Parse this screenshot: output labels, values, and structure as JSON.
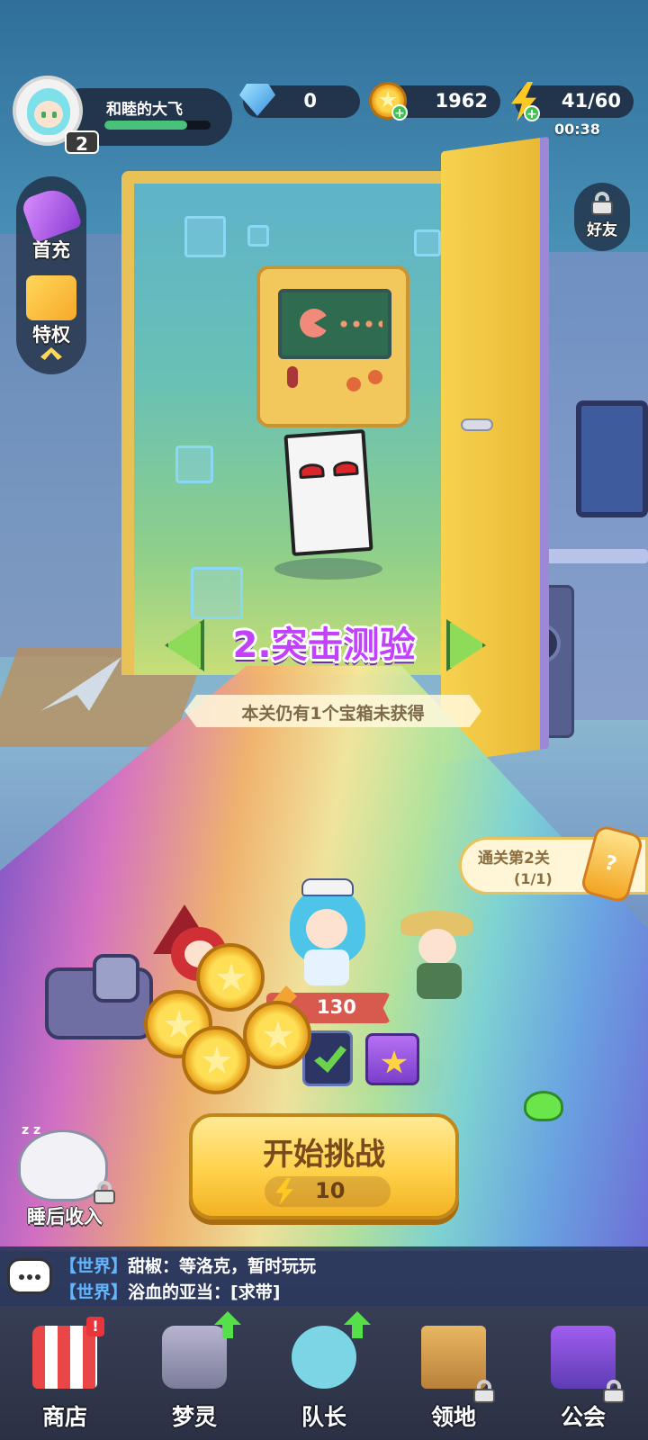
{
  "player": {
    "name": "和睦的大飞",
    "level": "2",
    "xp_progress": 0.78
  },
  "resources": {
    "diamonds": "0",
    "gold": "1962",
    "energy": "41/60",
    "energy_timer": "00:38"
  },
  "left_menu": {
    "first_charge": "首充",
    "privilege": "特权"
  },
  "friends_label": "好友",
  "stage": {
    "title": "2.突击测验",
    "subtitle": "本关仍有1个宝箱未获得"
  },
  "quest": {
    "title": "通关第2关",
    "progress": "(1/1)"
  },
  "team": {
    "power": "130"
  },
  "start_button": {
    "label": "开始挑战",
    "cost": "10"
  },
  "sleep_income_label": "睡后收入",
  "chat": {
    "lines": [
      {
        "channel": "【世界】",
        "text": "甜椒：等洛克，暂时玩玩"
      },
      {
        "channel": "【世界】",
        "text": "浴血的亚当：[求带]"
      }
    ]
  },
  "nav": {
    "items": [
      {
        "label": "商店",
        "icon": "shop-icon",
        "badge": "!"
      },
      {
        "label": "梦灵",
        "icon": "dream-spirit-icon",
        "upgrade": true
      },
      {
        "label": "队长",
        "icon": "captain-icon",
        "upgrade": true
      },
      {
        "label": "领地",
        "icon": "territory-icon",
        "locked": true
      },
      {
        "label": "公会",
        "icon": "guild-icon",
        "locked": true
      }
    ]
  },
  "colors": {
    "stage_title": "#c241ff",
    "start_button": "#ffd14a",
    "chat_channel": "#62b6ff",
    "xp_bar": "#48c27a"
  }
}
